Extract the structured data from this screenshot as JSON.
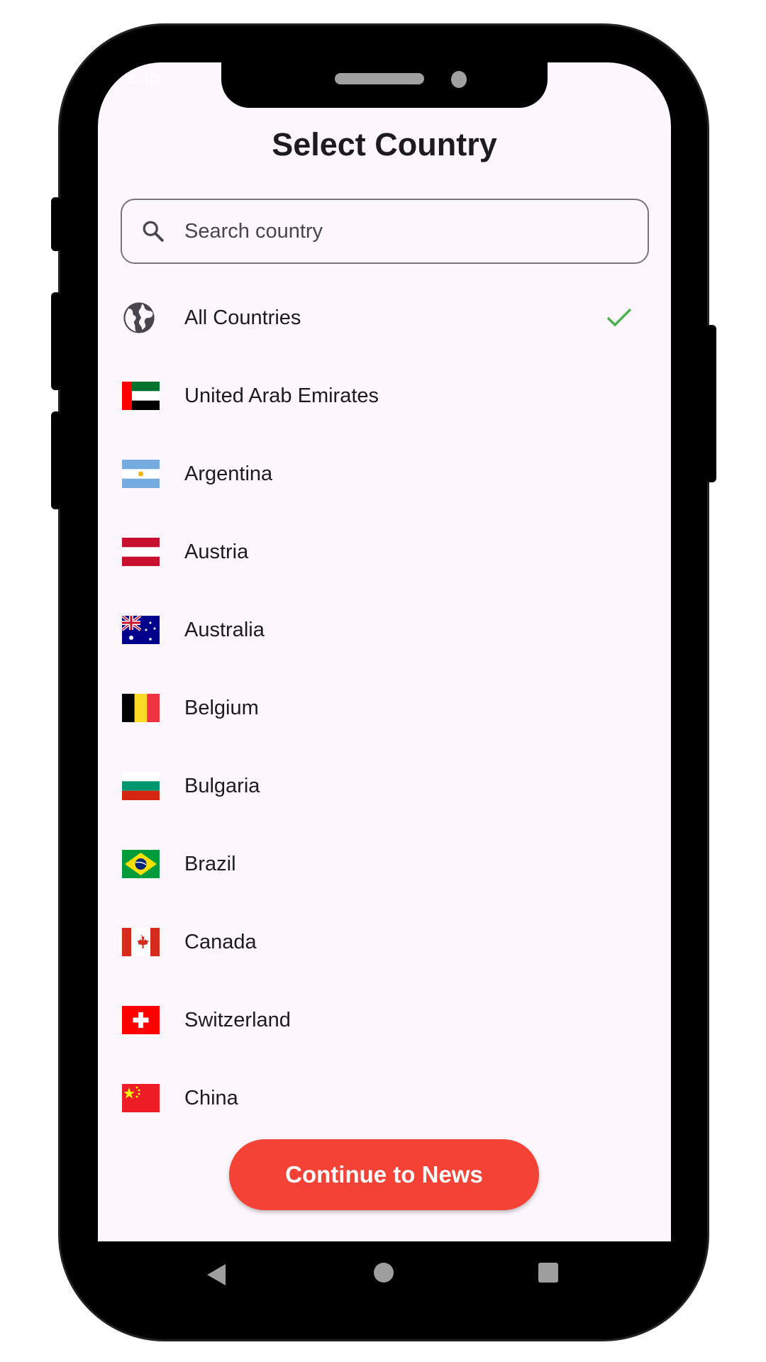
{
  "status_bar": {
    "time": "4:40"
  },
  "header": {
    "title": "Select Country"
  },
  "search": {
    "placeholder": "Search country",
    "value": "",
    "icon": "search-icon"
  },
  "list": [
    {
      "label": "All Countries",
      "icon": "globe-icon",
      "selected": true
    },
    {
      "label": "United Arab Emirates",
      "flag": "ae"
    },
    {
      "label": "Argentina",
      "flag": "ar"
    },
    {
      "label": "Austria",
      "flag": "at"
    },
    {
      "label": "Australia",
      "flag": "au"
    },
    {
      "label": "Belgium",
      "flag": "be"
    },
    {
      "label": "Bulgaria",
      "flag": "bg"
    },
    {
      "label": "Brazil",
      "flag": "br"
    },
    {
      "label": "Canada",
      "flag": "ca"
    },
    {
      "label": "Switzerland",
      "flag": "ch"
    },
    {
      "label": "China",
      "flag": "cn"
    }
  ],
  "cta": {
    "label": "Continue to News"
  },
  "colors": {
    "accent": "#f44336",
    "check": "#4caf50",
    "background": "#fdf6fd",
    "text": "#1d1b20"
  },
  "nav": [
    "back-icon",
    "home-icon",
    "recents-icon"
  ]
}
